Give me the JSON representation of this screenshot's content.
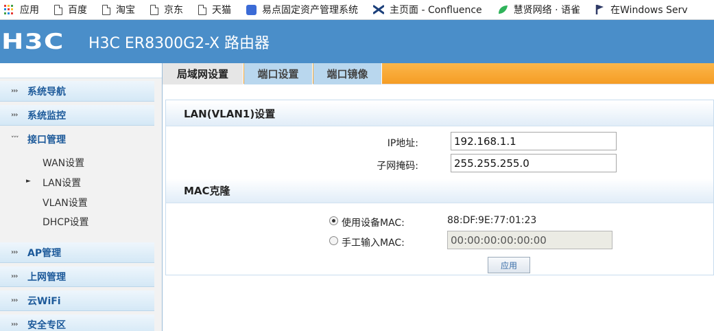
{
  "bookmarks": [
    {
      "icon": "apps-grid-icon",
      "label": "应用"
    },
    {
      "icon": "page-icon",
      "label": "百度"
    },
    {
      "icon": "page-icon",
      "label": "淘宝"
    },
    {
      "icon": "page-icon",
      "label": "京东"
    },
    {
      "icon": "page-icon",
      "label": "天猫"
    },
    {
      "icon": "blue-doc-icon",
      "label": "易点固定资产管理系统"
    },
    {
      "icon": "confluence-icon",
      "label": "主页面 - Confluence"
    },
    {
      "icon": "leaf-icon",
      "label": "慧贤网络 · 语雀"
    },
    {
      "icon": "p-flag-icon",
      "label": "在Windows Serv"
    }
  ],
  "header": {
    "logo": "H3C",
    "title": "H3C ER8300G2-X 路由器"
  },
  "sidebar": {
    "items": [
      {
        "label": "系统导航"
      },
      {
        "label": "系统监控"
      },
      {
        "label": "接口管理"
      },
      {
        "label": "AP管理"
      },
      {
        "label": "上网管理"
      },
      {
        "label": "云WiFi"
      },
      {
        "label": "安全专区"
      }
    ],
    "sub_items": [
      {
        "label": "WAN设置"
      },
      {
        "label": "LAN设置"
      },
      {
        "label": "VLAN设置"
      },
      {
        "label": "DHCP设置"
      }
    ]
  },
  "tabs": [
    {
      "label": "局域网设置"
    },
    {
      "label": "端口设置"
    },
    {
      "label": "端口镜像"
    }
  ],
  "lan": {
    "title": "LAN(VLAN1)设置",
    "ip_label": "IP地址:",
    "ip_value": "192.168.1.1",
    "mask_label": "子网掩码:",
    "mask_value": "255.255.255.0"
  },
  "mac": {
    "title": "MAC克隆",
    "use_device_label": "使用设备MAC:",
    "device_mac": "88:DF:9E:77:01:23",
    "manual_label": "手工输入MAC:",
    "manual_value": "00:00:00:00:00:00"
  },
  "apply_label": "应用",
  "colors": {
    "header_bg": "#4a8ec9",
    "tab_strip": "#f7a62e",
    "nav_text": "#1d5a9a"
  }
}
